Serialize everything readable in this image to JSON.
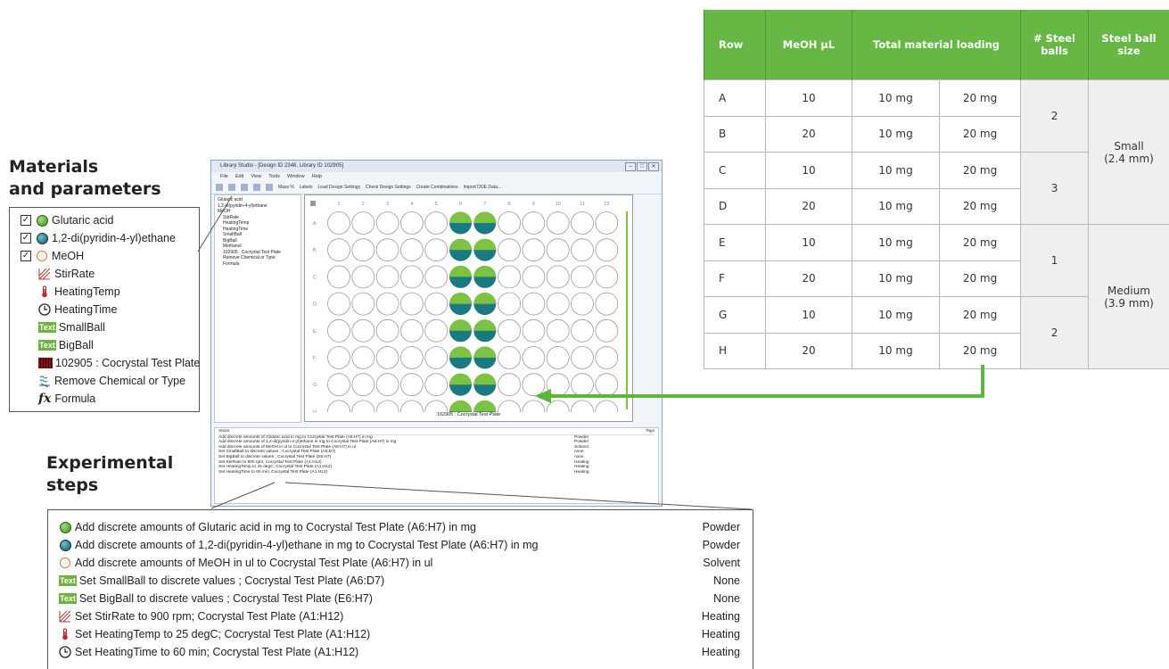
{
  "headings": {
    "materials": "Materials\nand parameters",
    "materials_line1": "Materials",
    "materials_line2": "and parameters",
    "steps_line1": "Experimental",
    "steps_line2": "steps"
  },
  "materials_panel": {
    "items": [
      {
        "label": "Glutaric acid",
        "checked": true,
        "icon": "green-dot-icon"
      },
      {
        "label": "1,2-di(pyridin-4-yl)ethane",
        "checked": true,
        "icon": "teal-dot-icon"
      },
      {
        "label": "MeOH",
        "checked": true,
        "icon": "orange-circle-icon"
      },
      {
        "label": "StirRate",
        "icon": "stir-rate-icon"
      },
      {
        "label": "HeatingTemp",
        "icon": "thermometer-icon"
      },
      {
        "label": "HeatingTime",
        "icon": "clock-icon"
      },
      {
        "label": "SmallBall",
        "icon": "text-icon"
      },
      {
        "label": "BigBall",
        "icon": "text-icon"
      },
      {
        "label": "102905 : Cocrystal Test Plate",
        "icon": "plate-icon"
      },
      {
        "label": "Remove Chemical or Type",
        "icon": "remove-chemical-icon"
      },
      {
        "label": "Formula",
        "icon": "formula-icon"
      }
    ],
    "text_icon_label": "Text"
  },
  "app": {
    "title": "Library Studio - [Design ID 2348, Library ID 102905]",
    "menu": [
      "File",
      "Edit",
      "View",
      "Tools",
      "Window",
      "Help"
    ],
    "toolbar": [
      "Mass %",
      "Labels",
      "Load Design Settings",
      "Check Design Settings",
      "Create Combinations",
      "Import DOE Data..."
    ],
    "tree": [
      "Glutaric acid",
      "1,2-di(pyridin-4-yl)ethane",
      "MeOH",
      "StirRate",
      "HeatingTemp",
      "HeatingTime",
      "SmallBall",
      "BigBall",
      "Methanol",
      "102905 : Cocrystal Test Plate",
      "Remove Chemical or Type",
      "Formula"
    ],
    "plate": {
      "label": "102905 : Cocrystal Test Plate",
      "columns": [
        "1",
        "2",
        "3",
        "4",
        "5",
        "6",
        "7",
        "8",
        "9",
        "10",
        "11",
        "12"
      ],
      "rows": [
        "A",
        "B",
        "C",
        "D",
        "E",
        "F",
        "G",
        "H"
      ],
      "filled_columns": [
        "6",
        "7"
      ]
    },
    "log": {
      "col_steps": "Steps",
      "col_tags": "Tags",
      "rows": [
        {
          "text": "Add discrete amounts of Glutaric acid in mg to Cocrystal Test Plate (A6:H7) in mg",
          "tag": "Powder"
        },
        {
          "text": "Add discrete amounts of 1,2-di(pyridin-4-yl)ethane in mg to Cocrystal Test Plate (A6:H7) in mg",
          "tag": "Powder"
        },
        {
          "text": "Add discrete amounts of MeOH in ul to Cocrystal Test Plate (A6:H7) in ul",
          "tag": "Solvent"
        },
        {
          "text": "Set SmallBall to discrete values ; Cocrystal Test Plate (A6:D7)",
          "tag": "none"
        },
        {
          "text": "Set BigBall to discrete values ; Cocrystal Test Plate (E6:H7)",
          "tag": "none"
        },
        {
          "text": "Set StirRate to 900 rpm; Cocrystal Test Plate (A1:H12)",
          "tag": "Heating"
        },
        {
          "text": "Set HeatingTemp to 25 degC; Cocrystal Test Plate (A1:H12)",
          "tag": "Heating"
        },
        {
          "text": "Set HeatingTime to 60 min; Cocrystal Test Plate (A1:H12)",
          "tag": "Heating"
        }
      ]
    }
  },
  "steps_panel": {
    "rows": [
      {
        "text": "Add discrete amounts of Glutaric acid in mg to Cocrystal Test Plate (A6:H7) in mg",
        "tag": "Powder",
        "icon": "green-dot-icon"
      },
      {
        "text": "Add discrete amounts of 1,2-di(pyridin-4-yl)ethane in mg to Cocrystal Test Plate (A6:H7) in mg",
        "tag": "Powder",
        "icon": "teal-dot-icon"
      },
      {
        "text": "Add discrete amounts of MeOH in ul to Cocrystal Test Plate (A6:H7) in ul",
        "tag": "Solvent",
        "icon": "orange-circle-icon"
      },
      {
        "text": "Set SmallBall to discrete values ; Cocrystal Test Plate (A6:D7)",
        "tag": "None",
        "icon": "text-icon"
      },
      {
        "text": "Set BigBall to discrete values ; Cocrystal Test Plate (E6:H7)",
        "tag": "None",
        "icon": "text-icon"
      },
      {
        "text": "Set StirRate to 900 rpm; Cocrystal Test Plate (A1:H12)",
        "tag": "Heating",
        "icon": "stir-rate-icon"
      },
      {
        "text": "Set HeatingTemp to 25 degC; Cocrystal Test Plate (A1:H12)",
        "tag": "Heating",
        "icon": "thermometer-icon"
      },
      {
        "text": "Set HeatingTime to 60 min; Cocrystal Test Plate (A1:H12)",
        "tag": "Heating",
        "icon": "clock-icon"
      }
    ]
  },
  "table": {
    "headers": {
      "row": "Row",
      "meoh": "MeOH µL",
      "loading": "Total material loading",
      "steel_balls": "# Steel balls",
      "ball_size": "Steel ball size"
    },
    "rows": [
      {
        "row": "A",
        "meoh": "10",
        "load1": "10 mg",
        "load2": "20 mg"
      },
      {
        "row": "B",
        "meoh": "20",
        "load1": "10 mg",
        "load2": "20 mg"
      },
      {
        "row": "C",
        "meoh": "10",
        "load1": "10 mg",
        "load2": "20 mg"
      },
      {
        "row": "D",
        "meoh": "20",
        "load1": "10 mg",
        "load2": "20 mg"
      },
      {
        "row": "E",
        "meoh": "10",
        "load1": "10 mg",
        "load2": "20 mg"
      },
      {
        "row": "F",
        "meoh": "20",
        "load1": "10 mg",
        "load2": "20 mg"
      },
      {
        "row": "G",
        "meoh": "10",
        "load1": "10 mg",
        "load2": "20 mg"
      },
      {
        "row": "H",
        "meoh": "20",
        "load1": "10 mg",
        "load2": "20 mg"
      }
    ],
    "steel_balls": [
      "2",
      "3",
      "1",
      "2"
    ],
    "ball_size": [
      {
        "name": "Small",
        "detail": "(2.4 mm)"
      },
      {
        "name": "Medium",
        "detail": "(3.9 mm)"
      }
    ]
  },
  "colors": {
    "accent_green": "#66b744",
    "well_teal": "#1a7a82",
    "well_green": "#7ec242",
    "arrow_green": "#5cb73a"
  }
}
